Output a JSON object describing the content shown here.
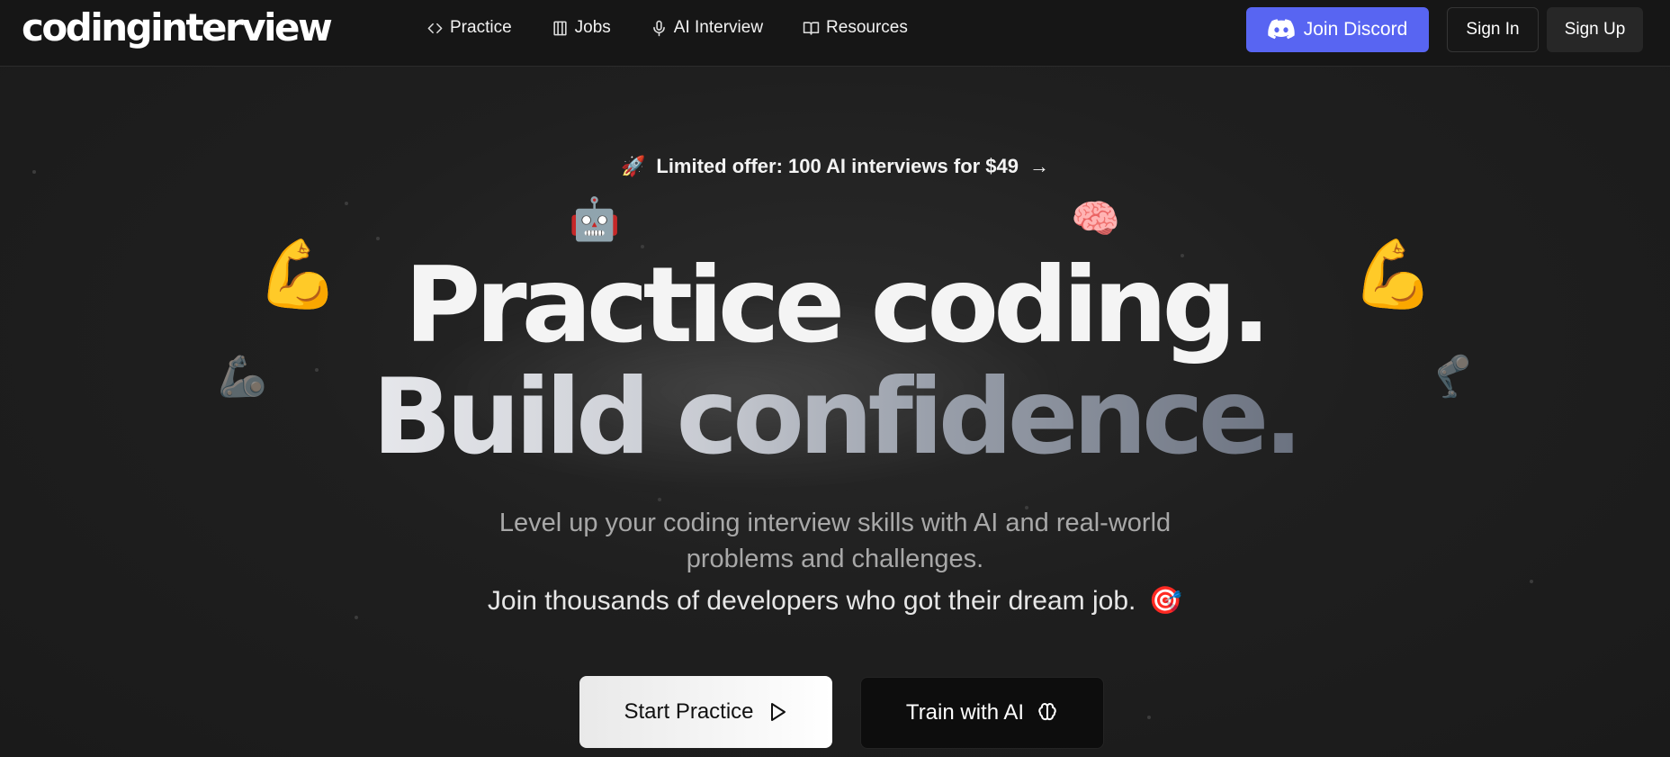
{
  "nav": {
    "logo": "codinginterview",
    "links": [
      {
        "label": "Practice",
        "icon": "code-icon"
      },
      {
        "label": "Jobs",
        "icon": "building-icon"
      },
      {
        "label": "AI Interview",
        "icon": "microphone-icon"
      },
      {
        "label": "Resources",
        "icon": "book-icon"
      }
    ],
    "discord_label": "Join Discord",
    "signin_label": "Sign In",
    "signup_label": "Sign Up"
  },
  "hero": {
    "offer": {
      "emoji": "🚀",
      "text": "Limited offer: 100 AI interviews for $49",
      "arrow": "→"
    },
    "headline_line1": "Practice coding.",
    "headline_line2": "Build confidence.",
    "subtitle": "Level up your coding interview skills with AI and real-world problems and challenges.",
    "join_text": "Join thousands of developers who got their dream job.",
    "join_emoji": "🎯",
    "start_button": "Start Practice",
    "train_button": "Train with AI"
  },
  "decorations": {
    "robot": "🤖",
    "brain": "🧠",
    "flexed_bicep": "💪",
    "mechanical_arm": "🦾",
    "mechanical_leg": "🦿"
  },
  "colors": {
    "background": "#1c1c1c",
    "discord": "#5865f2",
    "headline_gradient_end": "#6b7280"
  }
}
